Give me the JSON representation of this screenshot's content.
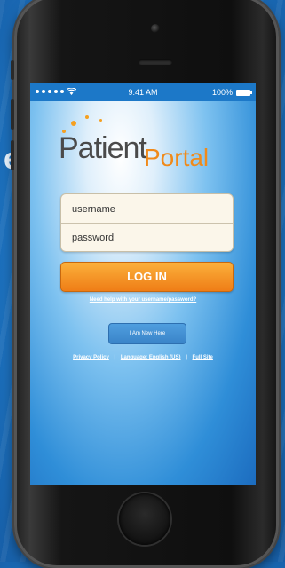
{
  "background": {
    "letter": "e"
  },
  "status_bar": {
    "time": "9:41 AM",
    "battery": "100%"
  },
  "logo": {
    "patient": "Patient",
    "portal": "Portal"
  },
  "login": {
    "username_placeholder": "username",
    "password_placeholder": "password",
    "button_label": "LOG IN",
    "help_link": "Need help with your username/password?"
  },
  "new_here_label": "I Am New Here",
  "footer": {
    "privacy": "Privacy Policy",
    "separator": "|",
    "language": "Language: English (US)",
    "full_site": "Full Site"
  },
  "colors": {
    "accent": "#f08a1a",
    "screen_blue": "#1c78c8"
  }
}
